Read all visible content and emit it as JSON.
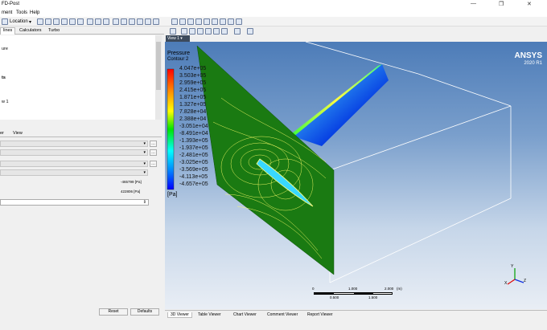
{
  "window": {
    "title": "FD-Post",
    "controls": [
      "—",
      "❐",
      "✕"
    ]
  },
  "menu": {
    "items": [
      "ment",
      "Tools",
      "Help"
    ]
  },
  "toolbar": {
    "location_label": "Location"
  },
  "left_tabs": {
    "items": [
      "lines",
      "Calculators",
      "Turbo"
    ]
  },
  "tree": {
    "items": [
      "ure",
      "ts",
      "w 1"
    ]
  },
  "detail_tabs": {
    "items": [
      "er",
      "View"
    ]
  },
  "properties": {
    "value_min": "-465799 [Pa]",
    "value_max": "422806 [Pa]",
    "spin_symbol": "⇕"
  },
  "buttons": {
    "reset": "Reset",
    "defaults": "Defaults"
  },
  "viewport": {
    "view_selector": "View 1",
    "brand": "ANSYS",
    "version": "2020 R1"
  },
  "legend": {
    "title": "Pressure",
    "subtitle": "Contour 2",
    "unit": "[Pa]",
    "levels": [
      "4.047e+05",
      "3.503e+05",
      "2.959e+05",
      "2.415e+05",
      "1.871e+05",
      "1.327e+05",
      "7.828e+04",
      "2.388e+04",
      "-3.051e+04",
      "-8.491e+04",
      "-1.393e+05",
      "-1.937e+05",
      "-2.481e+05",
      "-3.025e+05",
      "-3.569e+05",
      "-4.113e+05",
      "-4.657e+05"
    ],
    "colors": {
      "high": "#ff0000",
      "mid_high": "#ffff00",
      "mid": "#00e600",
      "mid_low": "#00c8ff",
      "low": "#0000ff"
    }
  },
  "scale_bar": {
    "top_labels": [
      "0",
      "1.000",
      "2.000",
      "(m)"
    ],
    "bottom_labels": [
      "0.500",
      "1.500"
    ]
  },
  "bottom_tabs": {
    "items": [
      "3D Viewer",
      "Table Viewer",
      "Chart Viewer",
      "Comment Viewer",
      "Report Viewer"
    ]
  },
  "axis": {
    "x": "X",
    "y": "Y",
    "z": "Z"
  }
}
